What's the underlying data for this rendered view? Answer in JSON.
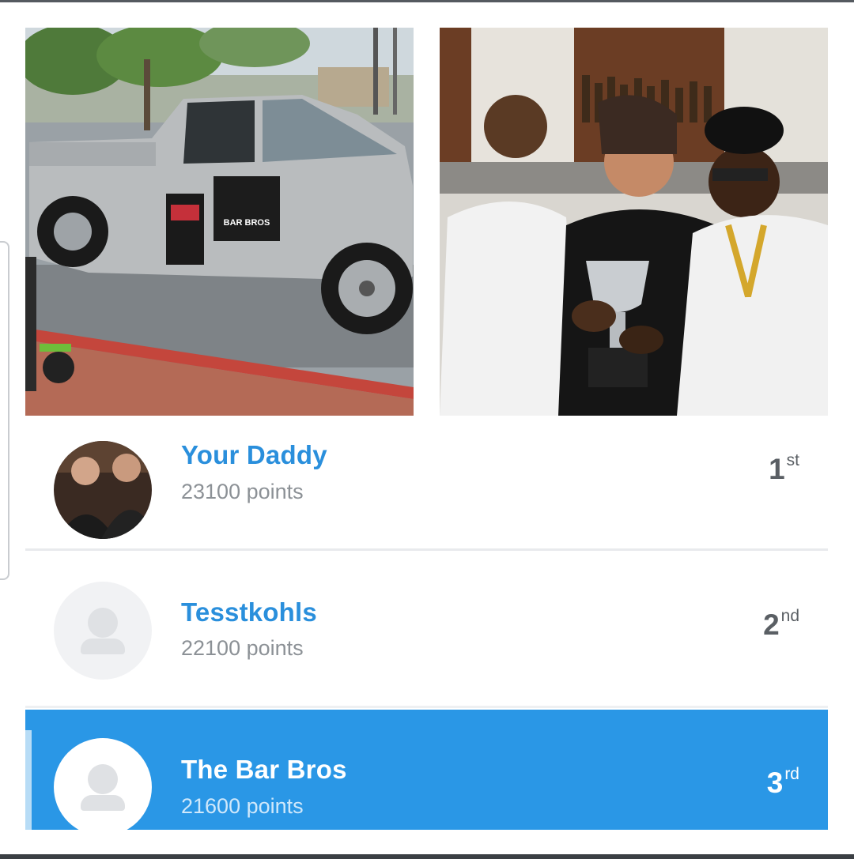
{
  "colors": {
    "highlight_row": "#2a97e6",
    "name_link": "#2a8fdc",
    "points_text": "#8c9196",
    "rank_text": "#5a5f64"
  },
  "photos": {
    "left": {
      "content": "silver pickup truck with stickers",
      "sticker_text": "The BAR BROS"
    },
    "right": {
      "content": "three people holding a trophy at a bar"
    }
  },
  "leaderboard": [
    {
      "name": "Your Daddy",
      "points": "23100 points",
      "rank_num": "1",
      "rank_suffix": "st",
      "avatar": "photo",
      "highlighted": false
    },
    {
      "name": "Tesstkohls",
      "points": "22100 points",
      "rank_num": "2",
      "rank_suffix": "nd",
      "avatar": "placeholder",
      "highlighted": false
    },
    {
      "name": "The Bar Bros",
      "points": "21600 points",
      "rank_num": "3",
      "rank_suffix": "rd",
      "avatar": "placeholder",
      "highlighted": true
    }
  ]
}
